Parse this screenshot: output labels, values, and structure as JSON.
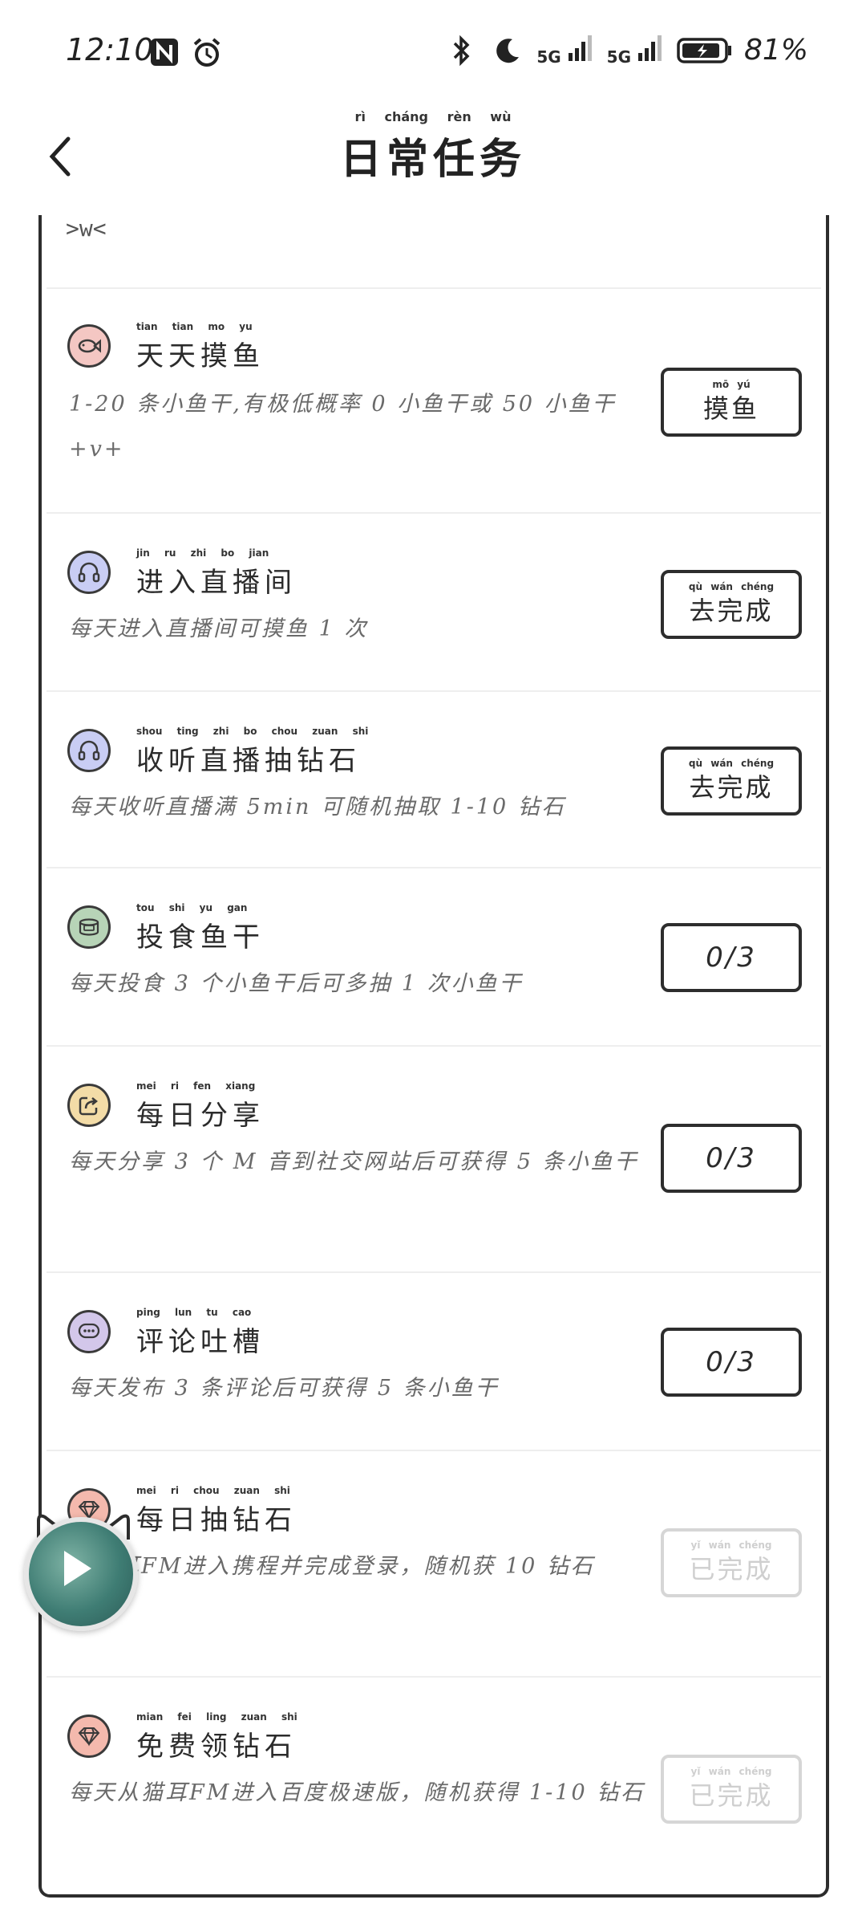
{
  "status_bar": {
    "time": "12:10",
    "battery_pct": "81%",
    "sig1": "5G",
    "sig2": "5G"
  },
  "nav": {
    "title": "日常任务",
    "title_pinyin": "rì cháng rèn wù"
  },
  "top_fragment": ">w<",
  "tasks": [
    {
      "title": "天天摸鱼",
      "title_pinyin": "tian tian mo yu",
      "desc": "1-20 条小鱼干,有极低概率 0 小鱼干或 50 小鱼干 +v+",
      "button_pinyin": "mō yú",
      "button": "摸鱼",
      "icon": "fish-icon",
      "icon_color": "#f4c7c3",
      "state": "action"
    },
    {
      "title": "进入直播间",
      "title_pinyin": "jin ru zhi bo jian",
      "desc": "每天进入直播间可摸鱼 1 次",
      "button_pinyin": "qù wán chéng",
      "button": "去完成",
      "icon": "headphones-icon",
      "icon_color": "#c9cdf4",
      "state": "action"
    },
    {
      "title": "收听直播抽钻石",
      "title_pinyin": "shou ting zhi bo chou zuan shi",
      "desc": "每天收听直播满 5min 可随机抽取 1-10 钻石",
      "button_pinyin": "qù wán chéng",
      "button": "去完成",
      "icon": "headphones-icon",
      "icon_color": "#c9cdf4",
      "state": "action"
    },
    {
      "title": "投食鱼干",
      "title_pinyin": "tou shi yu gan",
      "desc": "每天投食 3 个小鱼干后可多抽 1 次小鱼干",
      "button_pinyin": "",
      "button": "0/3",
      "icon": "can-icon",
      "icon_color": "#b7d4b7",
      "state": "progress"
    },
    {
      "title": "每日分享",
      "title_pinyin": "mei ri fen xiang",
      "desc": "每天分享 3 个 M 音到社交网站后可获得 5 条小鱼干",
      "button_pinyin": "",
      "button": "0/3",
      "icon": "share-icon",
      "icon_color": "#f3dca7",
      "state": "progress"
    },
    {
      "title": "评论吐槽",
      "title_pinyin": "ping lun tu cao",
      "desc": "每天发布 3 条评论后可获得 5 条小鱼干",
      "button_pinyin": "",
      "button": "0/3",
      "icon": "comment-icon",
      "icon_color": "#d3c7ea",
      "state": "progress"
    },
    {
      "title": "每日抽钻石",
      "title_pinyin": "mei ri chou zuan shi",
      "desc": "从猫耳FM进入携程并完成登录，随机获 10 钻石",
      "button_pinyin": "yǐ wán chéng",
      "button": "已完成",
      "icon": "diamond-icon",
      "icon_color": "#f4b9ad",
      "state": "done"
    },
    {
      "title": "免费领钻石",
      "title_pinyin": "mian fei ling zuan shi",
      "desc": "每天从猫耳FM进入百度极速版，随机获得 1-10 钻石",
      "button_pinyin": "yǐ wán chéng",
      "button": "已完成",
      "icon": "diamond-icon",
      "icon_color": "#f4b9ad",
      "state": "done"
    }
  ]
}
